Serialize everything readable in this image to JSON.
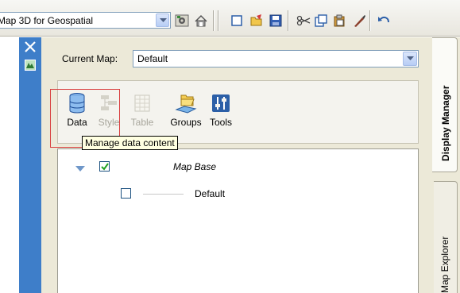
{
  "toolbar": {
    "workspace_value": "Map 3D for Geospatial",
    "icons": [
      "workspace-settings-icon",
      "workspace-home-icon",
      "new-icon",
      "open-icon",
      "save-icon",
      "cut-icon",
      "copy-icon",
      "paste-icon",
      "match-properties-icon",
      "undo-icon"
    ]
  },
  "palette": {
    "current_map_label": "Current Map:",
    "current_map_value": "Default",
    "tools": [
      {
        "label": "Data",
        "icon": "data-icon",
        "enabled": true
      },
      {
        "label": "Style",
        "icon": "style-icon",
        "enabled": false
      },
      {
        "label": "Table",
        "icon": "table-icon",
        "enabled": false
      },
      {
        "label": "Groups",
        "icon": "groups-icon",
        "enabled": true
      },
      {
        "label": "Tools",
        "icon": "tools-icon",
        "enabled": true
      }
    ],
    "tooltip": "Manage data content",
    "tree": {
      "base_label": "Map Base",
      "layer_label": "Default",
      "base_checked": true,
      "layer_checked": false
    }
  },
  "tabs": {
    "display_manager": "Display Manager",
    "map_explorer": "Map Explorer"
  },
  "colors": {
    "palette_strip": "#3e7ec9",
    "highlight": "#d94040",
    "tooltip_bg": "#ffffe1"
  }
}
